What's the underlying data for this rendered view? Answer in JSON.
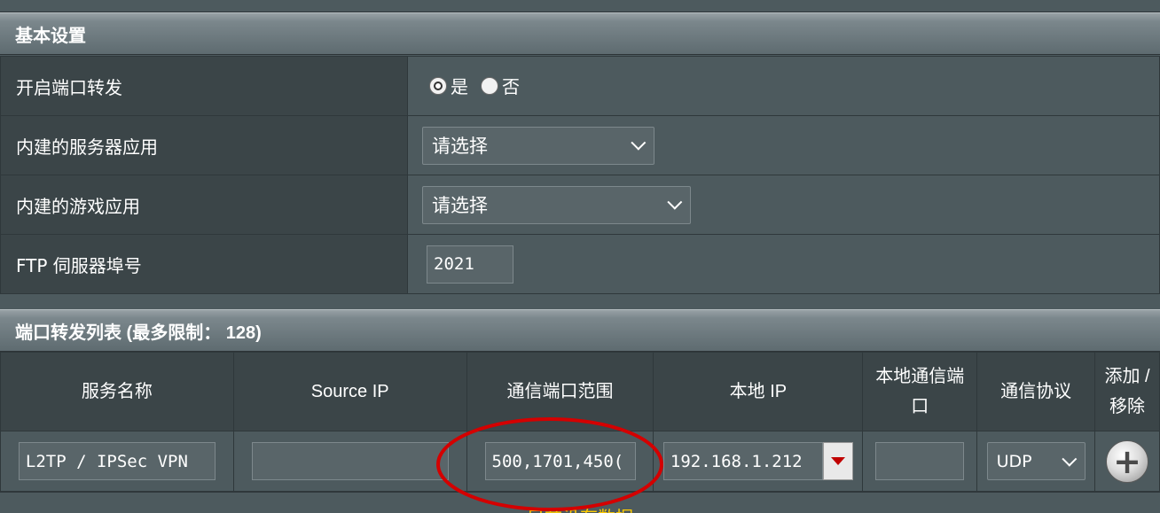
{
  "basic": {
    "title": "基本设置",
    "rows": [
      {
        "label": "开启端口转发",
        "options": [
          "是",
          "否"
        ],
        "selected": "是"
      },
      {
        "label": "内建的服务器应用",
        "select_value": "请选择"
      },
      {
        "label": "内建的游戏应用",
        "select_value": "请选择"
      },
      {
        "label": "FTP 伺服器埠号",
        "input_value": "2021"
      }
    ]
  },
  "list": {
    "title": "端口转发列表 (最多限制： 128)",
    "headers": [
      "服务名称",
      "Source IP",
      "通信端口范围",
      "本地 IP",
      "本地通信端口",
      "通信协议",
      "添加 / 移除"
    ],
    "row": {
      "service_name": "L2TP / IPSec VPN",
      "source_ip": "",
      "port_range": "500,1701,450(",
      "local_ip": "192.168.1.212",
      "local_port": "",
      "protocol": "UDP"
    },
    "empty_text": "目前没有数据"
  },
  "colors": {
    "annotation": "#d40000",
    "no_data_text": "#ffcc00"
  }
}
